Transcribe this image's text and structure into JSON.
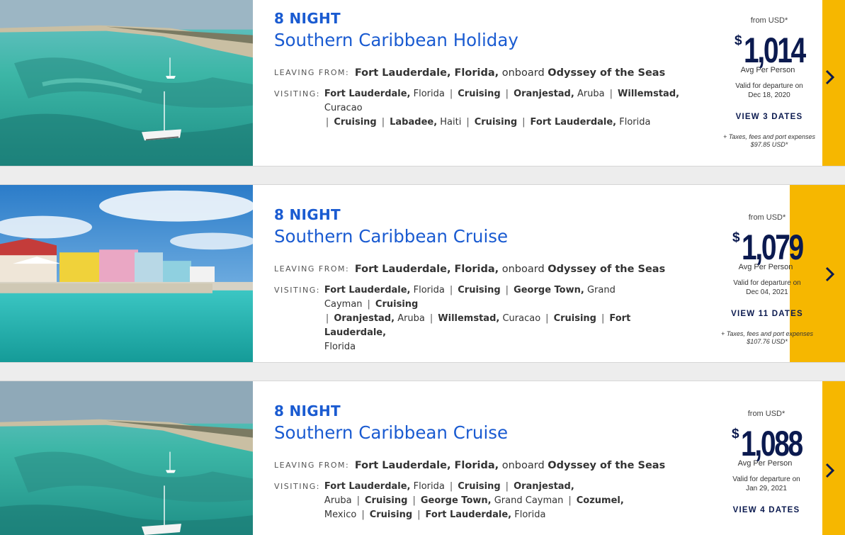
{
  "cards": [
    {
      "nights": "8 NIGHT",
      "title": "Southern Caribbean Holiday",
      "leaving_label": "LEAVING FROM:",
      "leaving_port": "Fort Lauderdale, Florida,",
      "onboard_text": "onboard",
      "ship": "Odyssey of the Seas",
      "visiting_label": "VISITING:",
      "ports": [
        {
          "name": "Fort Lauderdale,",
          "region": "Florida"
        },
        {
          "name": "Cruising",
          "region": ""
        },
        {
          "name": "Oranjestad,",
          "region": "Aruba"
        },
        {
          "name": "Willemstad,",
          "region": "Curacao"
        },
        {
          "name": "Cruising",
          "region": ""
        },
        {
          "name": "Labadee,",
          "region": "Haiti"
        },
        {
          "name": "Cruising",
          "region": ""
        },
        {
          "name": "Fort Lauderdale,",
          "region": "Florida"
        }
      ],
      "from_text": "from USD*",
      "currency_symbol": "$",
      "price": "1,014",
      "avg_text": "Avg Per Person",
      "valid_text": "Valid for departure on",
      "valid_date": "Dec 18, 2020",
      "dates_button": "VIEW 3 DATES",
      "taxes_text": "+ Taxes, fees and port expenses",
      "taxes_amount": "$97.85 USD*",
      "photo": "aruba-beach-catamaran",
      "next_icon": "chevron-right-icon"
    },
    {
      "nights": "8 NIGHT",
      "title": "Southern Caribbean Cruise",
      "leaving_label": "LEAVING FROM:",
      "leaving_port": "Fort Lauderdale, Florida,",
      "onboard_text": "onboard",
      "ship": "Odyssey of the Seas",
      "visiting_label": "VISITING:",
      "ports": [
        {
          "name": "Fort Lauderdale,",
          "region": "Florida"
        },
        {
          "name": "Cruising",
          "region": ""
        },
        {
          "name": "George Town,",
          "region": "Grand Cayman"
        },
        {
          "name": "Cruising",
          "region": ""
        },
        {
          "name": "Oranjestad,",
          "region": "Aruba"
        },
        {
          "name": "Willemstad,",
          "region": "Curacao"
        },
        {
          "name": "Cruising",
          "region": ""
        },
        {
          "name": "Fort Lauderdale,",
          "region": "Florida"
        }
      ],
      "from_text": "from USD*",
      "currency_symbol": "$",
      "price": "1,079",
      "avg_text": "Avg Per Person",
      "valid_text": "Valid for departure on",
      "valid_date": "Dec 04, 2021",
      "dates_button": "VIEW 11 DATES",
      "taxes_text": "+ Taxes, fees and port expenses",
      "taxes_amount": "$107.76 USD*",
      "photo": "grand-cayman-waterfront",
      "next_icon": "chevron-right-icon"
    },
    {
      "nights": "8 NIGHT",
      "title": "Southern Caribbean Cruise",
      "leaving_label": "LEAVING FROM:",
      "leaving_port": "Fort Lauderdale, Florida,",
      "onboard_text": "onboard",
      "ship": "Odyssey of the Seas",
      "visiting_label": "VISITING:",
      "ports": [
        {
          "name": "Fort Lauderdale,",
          "region": "Florida"
        },
        {
          "name": "Cruising",
          "region": ""
        },
        {
          "name": "Oranjestad,",
          "region": "Aruba"
        },
        {
          "name": "Cruising",
          "region": ""
        },
        {
          "name": "George Town,",
          "region": "Grand Cayman"
        },
        {
          "name": "Cozumel,",
          "region": "Mexico"
        },
        {
          "name": "Cruising",
          "region": ""
        },
        {
          "name": "Fort Lauderdale,",
          "region": "Florida"
        }
      ],
      "from_text": "from USD*",
      "currency_symbol": "$",
      "price": "1,088",
      "avg_text": "Avg Per Person",
      "valid_text": "Valid for departure on",
      "valid_date": "Jan 29, 2021",
      "dates_button": "VIEW 4 DATES",
      "photo": "aruba-beach-catamaran",
      "next_icon": "chevron-right-icon"
    }
  ]
}
